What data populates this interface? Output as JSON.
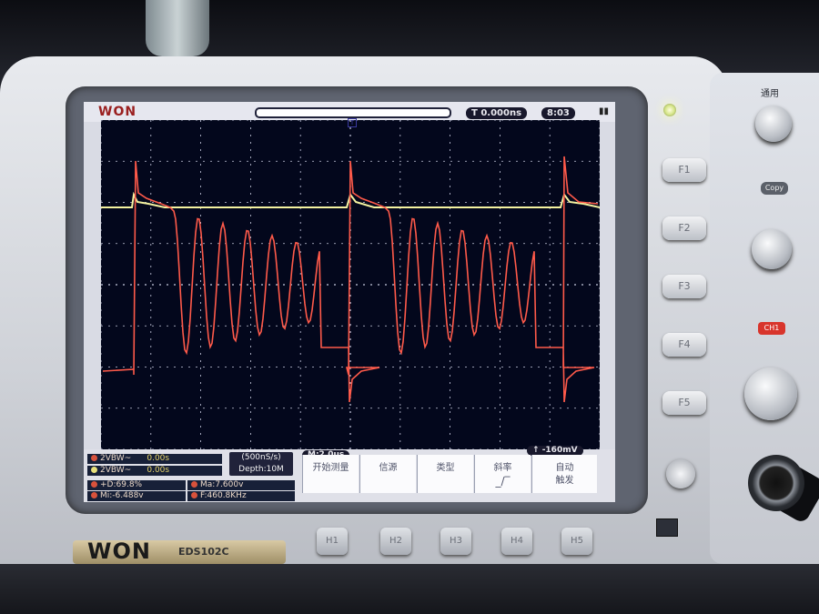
{
  "device": {
    "brand": "WON",
    "model": "EDS102C"
  },
  "screen": {
    "logo": "WON",
    "trigger_position": "0.000ns",
    "clock": "8:03"
  },
  "status": {
    "ch1_bw": "2VBW~",
    "ch1_val": "0.00s",
    "ch2_bw": "2VBW~",
    "ch2_val": "0.00s",
    "timebase": "(500nS/s)",
    "depth": "Depth:10M",
    "window": "M:2.0us",
    "trigger_level": "-160mV",
    "meas_duty": "+D:69.8%",
    "meas_max": "Ma:7.600v",
    "meas_min": "Mi:-6.488v",
    "meas_freq": "F:460.8KHz"
  },
  "menu": [
    {
      "label": "开始测量"
    },
    {
      "label": "信源"
    },
    {
      "label": "类型"
    },
    {
      "label": "斜率"
    },
    {
      "label": "自动",
      "sub": "触发"
    }
  ],
  "side_buttons": [
    "F1",
    "F2",
    "F3",
    "F4",
    "F5"
  ],
  "bottom_buttons": [
    "H1",
    "H2",
    "H3",
    "H4",
    "H5"
  ],
  "right_panel": {
    "label_general": "通用",
    "label_copy": "Copy",
    "label_ch1": "CH1"
  },
  "colors": {
    "ch1_trace": "#ff5a4a",
    "ch2_trace": "#f4f2a0",
    "grid": "#c8cbe0",
    "scope_bg": "#03071c"
  }
}
